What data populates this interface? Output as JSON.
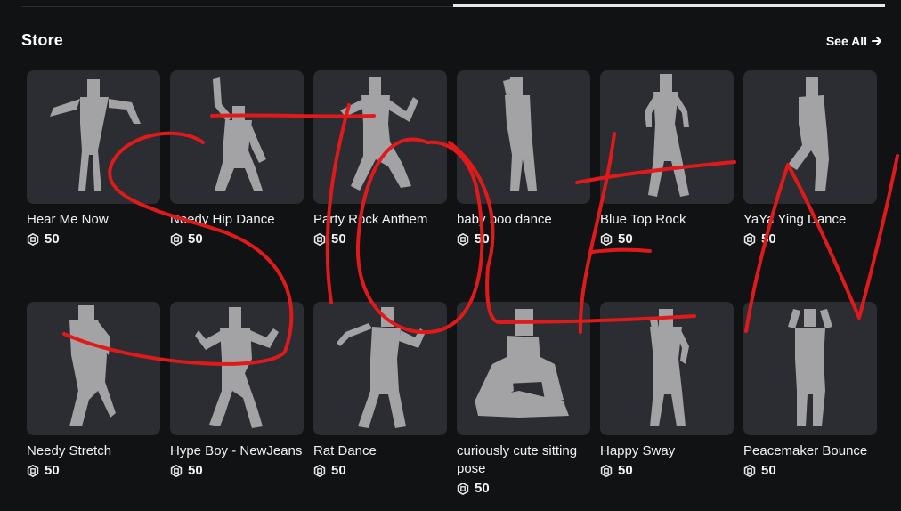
{
  "header": {
    "title": "Store",
    "see_all_label": "See All"
  },
  "items": [
    {
      "name": "Hear Me Now",
      "price": "50",
      "pose": "wave"
    },
    {
      "name": "Needy Hip Dance",
      "price": "50",
      "pose": "armup"
    },
    {
      "name": "Party Rock Anthem",
      "price": "50",
      "pose": "party"
    },
    {
      "name": "baby boo dance",
      "price": "50",
      "pose": "lean"
    },
    {
      "name": "Blue Top Rock",
      "price": "50",
      "pose": "stand"
    },
    {
      "name": "YaYa Ying Dance",
      "price": "50",
      "pose": "side"
    },
    {
      "name": "Needy Stretch",
      "price": "50",
      "pose": "bend"
    },
    {
      "name": "Hype Boy - NewJeans",
      "price": "50",
      "pose": "hype"
    },
    {
      "name": "Rat Dance",
      "price": "50",
      "pose": "rat"
    },
    {
      "name": "curiously cute sitting pose",
      "price": "50",
      "pose": "sit"
    },
    {
      "name": "Happy Sway",
      "price": "50",
      "pose": "sway"
    },
    {
      "name": "Peacemaker Bounce",
      "price": "50",
      "pose": "hands"
    }
  ],
  "overlay": {
    "scribble_text": "STOLEN",
    "color": "#e01a1a"
  },
  "colors": {
    "background": "#111214",
    "card": "#2b2d33",
    "figure": "#a3a3a6"
  },
  "icons": {
    "currency": "robux-icon",
    "arrow": "arrow-right-icon"
  }
}
